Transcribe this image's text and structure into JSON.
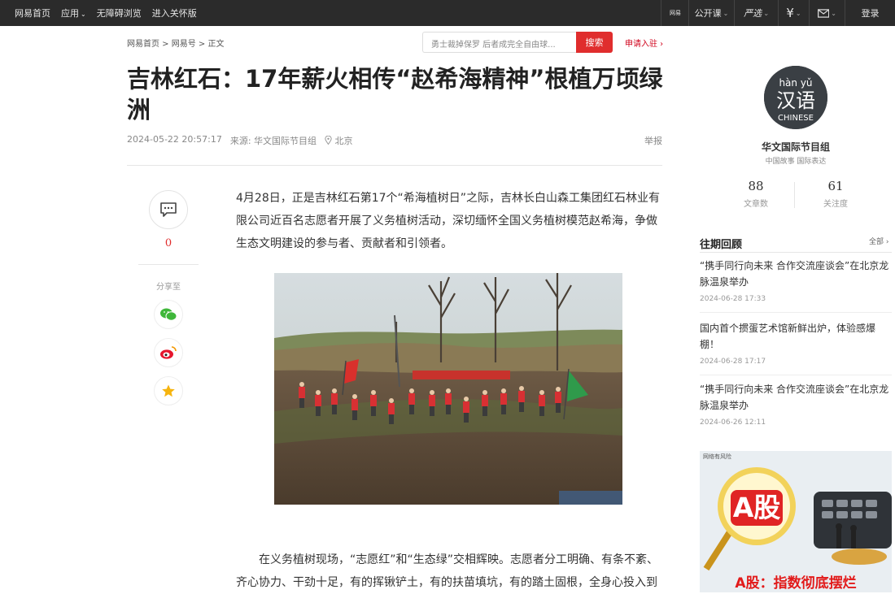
{
  "topbar": {
    "left": [
      "网易首页",
      "应用",
      "无障碍浏览",
      "进入关怀版"
    ],
    "right": {
      "app_label": "网易",
      "open_course": "公开课",
      "yanxuan": "严选",
      "login": "登录"
    }
  },
  "breadcrumb": "网易首页 > 网易号 > 正文",
  "search": {
    "placeholder": "勇士裁掉保罗 后者成完全自由球...",
    "button": "搜索"
  },
  "apply_link": "申请入驻 ›",
  "article": {
    "title": "吉林红石：17年薪火相传“赵希海精神”根植万顷绿洲",
    "date": "2024-05-22 20:57:17",
    "source": "来源: 华文国际节目组",
    "location": "北京",
    "report": "举报",
    "para1": "4月28日，正是吉林红石第17个“希海植树日”之际，吉林长白山森工集团红石林业有限公司近百名志愿者开展了义务植树活动，深切缅怀全国义务植树模范赵希海，争做生态文明建设的参与者、贡献者和引领者。",
    "para2": "在义务植树现场，“志愿红”和“生态绿”交相辉映。志愿者分工明确、有条不紊、齐心协力、干劲十足，有的挥锹铲土，有的扶苗填坑，有的踏土固根，全身心投入到"
  },
  "share": {
    "comment_count": "0",
    "share_label": "分享至"
  },
  "author": {
    "avatar_text_top": "hàn yǔ",
    "avatar_text_mid": "汉语",
    "avatar_text_bottom": "CHINESE",
    "name": "华文国际节目组",
    "tagline": "中国故事 国际表达",
    "articles": "88",
    "articles_label": "文章数",
    "follows": "61",
    "follows_label": "关注度"
  },
  "past": {
    "title": "往期回顾",
    "all": "全部 ›",
    "items": [
      {
        "title": "“携手同行向未来 合作交流座谈会”在北京龙脉温泉举办",
        "date": "2024-06-28 17:33"
      },
      {
        "title": "国内首个掼蛋艺术馆新鲜出炉，体验感爆棚！",
        "date": "2024-06-28 17:17"
      },
      {
        "title": "“携手同行向未来 合作交流座谈会”在北京龙脉温泉举办",
        "date": "2024-06-26 12:11"
      }
    ]
  },
  "ad": {
    "small": "网络有风险",
    "badge": "A股",
    "headline": "A股：指数彻底摆烂"
  },
  "colors": {
    "topbar": "#2b2b2b",
    "accent_red": "#e02d2d"
  }
}
